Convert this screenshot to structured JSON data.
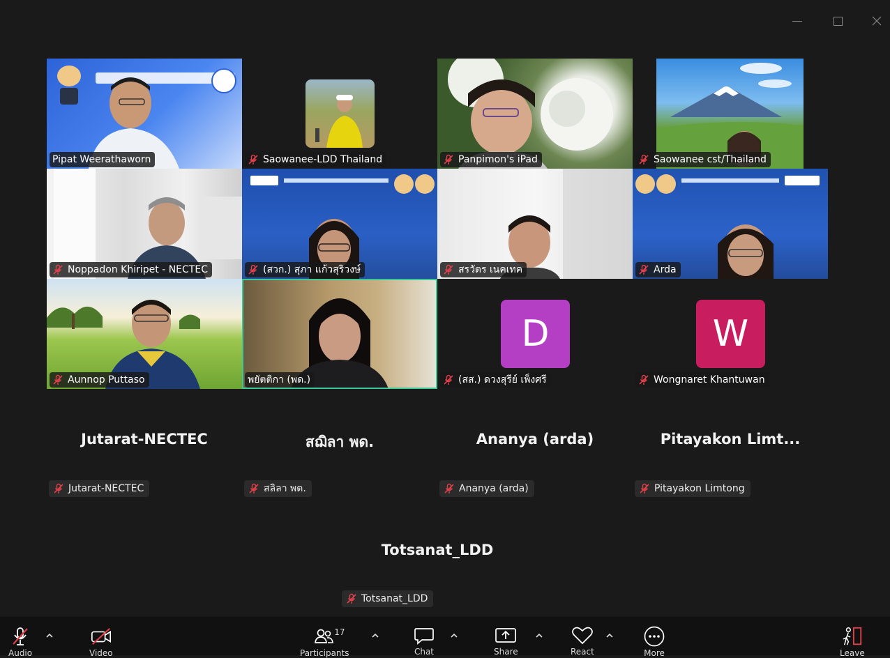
{
  "window": {
    "controls": [
      "minimize",
      "maximize",
      "close"
    ]
  },
  "tiles": [
    {
      "name": "Pipat Weerathaworn",
      "muted": false,
      "video": true
    },
    {
      "name": "Saowanee-LDD Thailand",
      "muted": true,
      "video": true
    },
    {
      "name": "Panpimon's iPad",
      "muted": true,
      "video": true
    },
    {
      "name": "Saowanee cst/Thailand",
      "muted": true,
      "video": true
    },
    {
      "name": "Noppadon Khiripet - NECTEC",
      "muted": true,
      "video": true
    },
    {
      "name": "(สวก.) สุภา แก้วสุริวงษ์",
      "muted": true,
      "video": true
    },
    {
      "name": "สรวัตร เนคเทค",
      "muted": true,
      "video": true
    },
    {
      "name": "Arda",
      "muted": true,
      "video": true
    },
    {
      "name": "Aunnop Puttaso",
      "muted": true,
      "video": true
    },
    {
      "name": "พยัตติกา (พด.)",
      "muted": false,
      "video": true,
      "active_speaker": true
    },
    {
      "name": "(สส.) ดวงสุรีย์ เพ็งศรี",
      "muted": true,
      "video": false,
      "avatar_letter": "D",
      "avatar_color": "#b43fc4"
    },
    {
      "name": "Wongnaret Khantuwan",
      "muted": true,
      "video": false,
      "avatar_letter": "W",
      "avatar_color": "#c81d5e"
    }
  ],
  "audio_only": [
    {
      "display": "Jutarat-NECTEC",
      "tag": "Jutarat-NECTEC"
    },
    {
      "display": "สฌิลา พด.",
      "tag": "สลิลา พด."
    },
    {
      "display": "Ananya (arda)",
      "tag": "Ananya (arda)"
    },
    {
      "display": "Pitayakon  Limt...",
      "tag": "Pitayakon Limtong"
    },
    {
      "display": "Totsanat_LDD",
      "tag": "Totsanat_LDD"
    }
  ],
  "toolbar": {
    "audio_label": "Audio",
    "video_label": "Video",
    "participants_label": "Participants",
    "participants_count": "17",
    "chat_label": "Chat",
    "share_label": "Share",
    "react_label": "React",
    "more_label": "More",
    "leave_label": "Leave"
  },
  "colors": {
    "active_border": "#3ec99a",
    "muted_icon": "#e0404a",
    "background": "#1a1a1a"
  }
}
